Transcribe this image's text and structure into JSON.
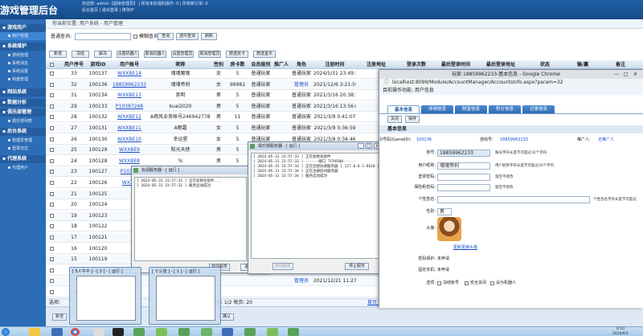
{
  "header": {
    "title": "游戏管理后台",
    "info_line1": "欢迎您: admin【超级管理员】 | 所有未处理的操作: 0 | 所有新订单: 0",
    "info_line2": "后台首页 | 退出登录 | 修改IP"
  },
  "sidebar": [
    {
      "type": "group",
      "label": "游戏用户"
    },
    {
      "type": "sub",
      "label": "用户管理",
      "active": true
    },
    {
      "type": "group",
      "label": "系统维护"
    },
    {
      "type": "sub",
      "label": "游戏管理"
    },
    {
      "type": "sub",
      "label": "系统消息"
    },
    {
      "type": "sub",
      "label": "系统设置"
    },
    {
      "type": "sub",
      "label": "转盘管理"
    },
    {
      "type": "group",
      "label": "网站系统"
    },
    {
      "type": "group",
      "label": "数据分析"
    },
    {
      "type": "group",
      "label": "俱乐部管理"
    },
    {
      "type": "sub",
      "label": "俱乐部列表"
    },
    {
      "type": "group",
      "label": "后台系统"
    },
    {
      "type": "sub",
      "label": "管理员管理"
    },
    {
      "type": "sub",
      "label": "登录日志"
    },
    {
      "type": "group",
      "label": "代理系统"
    },
    {
      "type": "sub",
      "label": "代理用户"
    }
  ],
  "breadcrumb": "你当前位置: 用户系统 - 用户管理",
  "search": {
    "label": "普通查询:",
    "value": "",
    "fuzzy_label": "模糊查询",
    "query_btn": "查询",
    "choose_btn": "选中查询",
    "refresh_btn": "刷新"
  },
  "toolbar": [
    "新增",
    "冻结",
    "解冻",
    "设置机器人",
    "取消机器人",
    "设置管理员",
    "取消管理员",
    "赠送房卡",
    "赠送金币"
  ],
  "table": {
    "columns": [
      "",
      "用户序号",
      "游戏ID",
      "用户账号",
      "昵称",
      "性别",
      "房卡数",
      "会员级别",
      "推广人",
      "角色",
      "注册时间",
      "注册地址",
      "登录次数",
      "最后登录时间",
      "最后登录地址",
      "状态",
      "输/赢",
      "备注"
    ],
    "rows": [
      [
        "",
        "33",
        "100137",
        "WXXBE14",
        "魂魂魔咖",
        "女",
        "5",
        "普通玩家",
        "",
        "普通玩家",
        "2024/5/31 23:49:32"
      ],
      [
        "",
        "32",
        "100136",
        "18859962233",
        "魂魂帝刹",
        "女",
        "99981",
        "普通玩家",
        "",
        "管理员",
        "2021/12/6 3:21:59"
      ],
      [
        "",
        "31",
        "100134",
        "WXXBE13",
        "崇明",
        "男",
        "5",
        "普通玩家",
        "",
        "普通玩家",
        "2021/3/16 20:38:14"
      ],
      [
        "",
        "29",
        "100133",
        "P10387248",
        "kuai2020",
        "男",
        "5",
        "普通玩家",
        "",
        "普通玩家",
        "2021/3/16 13:56:05"
      ],
      [
        "",
        "28",
        "100132",
        "WXXBE12",
        "A雨风业务帐号2469427780",
        "男",
        "11",
        "普通玩家",
        "",
        "普通玩家",
        "2021/3/9 0:41:07"
      ],
      [
        "",
        "27",
        "100131",
        "WXXBE11",
        "A雨霜",
        "女",
        "5",
        "普通玩家",
        "",
        "普通玩家",
        "2021/3/9 0:36:59"
      ],
      [
        "",
        "26",
        "100130",
        "WXXBE10",
        "幸运星",
        "女",
        "5",
        "普通玩家",
        "",
        "普通玩家",
        "2021/3/9 0:34:46"
      ],
      [
        "",
        "25",
        "100129",
        "WXXBE9",
        "阳光天使",
        "男",
        "5",
        "普通玩家",
        "",
        "普通玩家",
        "2021/3/9 0:32:05"
      ],
      [
        "",
        "24",
        "100128",
        "WXXBE8",
        "%",
        "男",
        "5",
        "普通玩家",
        "",
        "普通玩家",
        "2021/3/9 0:29:51"
      ],
      [
        "",
        "23",
        "100127",
        "P10387",
        "",
        "",
        "",
        "",
        "",
        "",
        ""
      ],
      [
        "",
        "22",
        "100126",
        "WXXB",
        "",
        "",
        "",
        "",
        "",
        "",
        ""
      ],
      [
        "",
        "21",
        "100125",
        "",
        "",
        "",
        "",
        "",
        "",
        "",
        ""
      ],
      [
        "",
        "20",
        "100124",
        "",
        "",
        "",
        "",
        "",
        "",
        "",
        ""
      ],
      [
        "",
        "19",
        "100123",
        "",
        "",
        "",
        "",
        "",
        "",
        "",
        ""
      ],
      [
        "",
        "18",
        "100122",
        "",
        "",
        "",
        "",
        "",
        "",
        "",
        ""
      ],
      [
        "",
        "17",
        "100121",
        "",
        "",
        "",
        "",
        "",
        "",
        "",
        ""
      ],
      [
        "",
        "16",
        "100120",
        "",
        "",
        "",
        "",
        "",
        "",
        "",
        ""
      ],
      [
        "",
        "15",
        "100119",
        "",
        "",
        "",
        "",
        "",
        "",
        "",
        ""
      ],
      [
        "",
        "14",
        "100118",
        "WXXBE",
        "",
        "",
        "",
        "",
        "",
        "管理员",
        "2021/12/21 11:27:41"
      ],
      [
        "",
        "13",
        "100117",
        "WXXBE",
        "",
        "",
        "",
        "",
        "",
        "管理员",
        "2021/12/21 11:27:41"
      ],
      [
        "",
        "12",
        "100116",
        "",
        "",
        "",
        "",
        "",
        "",
        "",
        ""
      ]
    ]
  },
  "status_bar": {
    "left": "选项:",
    "pager": "共 页，当前页: 1/2  每页: 20",
    "pager_links": "首页 上页 下页 末页",
    "goto_value": "1",
    "goto_btn": "go"
  },
  "bottom_buttons": [
    "新增",
    "确认"
  ],
  "win_coord": {
    "title": "协调服务器 - [ 运行 ]",
    "log": [
      "[ 2024-05-31 23:57:33 ] 正在初始化组件...",
      "[ 2024-05-31 23:57:33 ] 服务启动成功"
    ],
    "btn_start": "启动服务",
    "btn_exit": "退出系统"
  },
  "win_club": {
    "title": "俱乐部服务器 - [ 运行 ]",
    "controls": [
      "_",
      "□",
      "×"
    ],
    "log": [
      "[ 2024-05-31 23:57:33 ] 正在初始化组件",
      "[ 2024-05-31 23:57:33 ] ------端口 TCP4500------",
      "[ 2024-05-31 23:57:33 ] 正在连接协调服务器 [ 127.0.0.1:8610 ]",
      "[ 2024-05-31 23:57:34 ] 正在注册房间服务器",
      "[ 2024-05-31 23:57:34 ] 服务启动成功"
    ],
    "btn_start": "启动服务",
    "btn_stop": "停止服务"
  },
  "thumbs": [
    {
      "title": "[ 5人牛牛 ] - [ 2 ] - [ 运行 ]"
    },
    {
      "title": "[ 十三张 ] - [ 1 ] - [ 运行 ]"
    }
  ],
  "chrome": {
    "title": "玩家:18859962233-基本信息 - Google Chrome",
    "url": "localhost:8099/Module/AccountManager/AccountsInfo.aspx?param=32",
    "breadcrumb": "目前操作功能: 用户信息",
    "tabs": [
      "基本信息",
      "详细信息",
      "财富信息",
      "积分信息",
      "记录信息"
    ],
    "actions": [
      "关闭",
      "保存"
    ],
    "section_title": "基本信息",
    "fields": {
      "game_id_label": "ID号码(GameID):",
      "game_id": "100136",
      "account_label": "账号:",
      "account": "18859962233",
      "account_hint": "账号字符长度不可超过32个字符",
      "nickname_label": "用户昵称:",
      "nickname": "魂魂帝刹",
      "nickname_hint": "用户昵称字符长度不可超过32个字符",
      "login_pwd_label": "登录密码:",
      "login_pwd_hint": "留空不修改",
      "bank_pwd_label": "保险柜密码:",
      "bank_pwd_hint": "留空不修改",
      "signature_label": "个性签名:",
      "signature_hint": "个性签名字符长度不可超过",
      "gender_label": "性别:",
      "gender": "男",
      "avatar_label": "头像:",
      "avatar_link": "更新更换头像",
      "pwd_protect_label": "密码保护:",
      "pwd_protect": "未申请",
      "id_verify_label": "固定本机:",
      "id_verify": "未申请",
      "options_label": "选项:",
      "opt_freeze": "冻结帐号",
      "opt_safe_close": "安全关闭",
      "opt_robot": "设为机器人",
      "spreader_label": "推广人:",
      "spreader": "无推广人",
      "game_num_label": "游戏号:",
      "game_num": "18859962233"
    }
  },
  "clock": {
    "time": "0:10",
    "date": "2024/6/1"
  },
  "colors": {
    "header": "#1f5fa8",
    "sidebar": "#2c6db6",
    "link": "#1a4fd0",
    "tab": "#2f6db4"
  }
}
